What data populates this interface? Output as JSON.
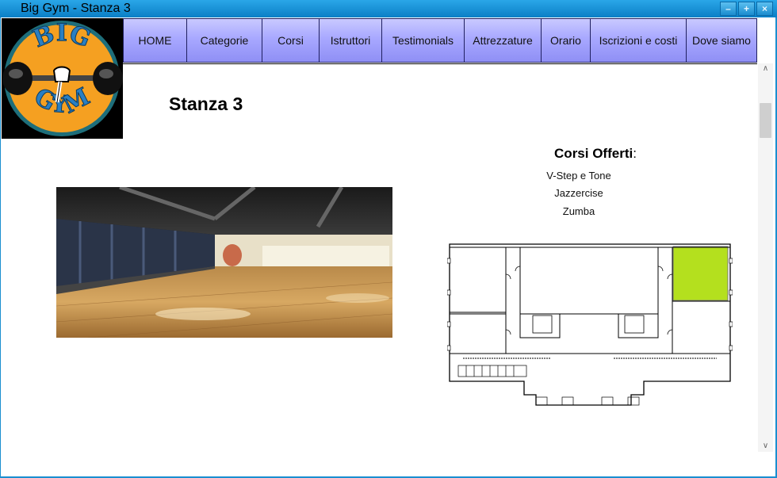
{
  "window": {
    "title": "Big Gym - Stanza 3",
    "controls": [
      "–",
      "+",
      "×"
    ]
  },
  "logo": {
    "text_top": "BIG",
    "text_bottom": "GYM"
  },
  "nav": [
    {
      "label": "HOME"
    },
    {
      "label": "Categorie"
    },
    {
      "label": "Corsi"
    },
    {
      "label": "Istruttori"
    },
    {
      "label": "Testimonials"
    },
    {
      "label": "Attrezzature"
    },
    {
      "label": "Orario"
    },
    {
      "label": "Iscrizioni e costi"
    },
    {
      "label": "Dove siamo"
    }
  ],
  "page": {
    "title": "Stanza 3",
    "courses_heading": "Corsi Offerti",
    "courses_heading_suffix": ":",
    "courses": [
      "V-Step e Tone",
      "Jazzercise",
      "Zumba"
    ]
  },
  "colors": {
    "nav_gradient_top": "#c9c9ff",
    "nav_gradient_bottom": "#8f8ff5",
    "highlight_room": "#b4e01e",
    "titlebar": "#1a8fd0"
  },
  "scrollbar": {
    "up": "∧",
    "down": "∨"
  }
}
